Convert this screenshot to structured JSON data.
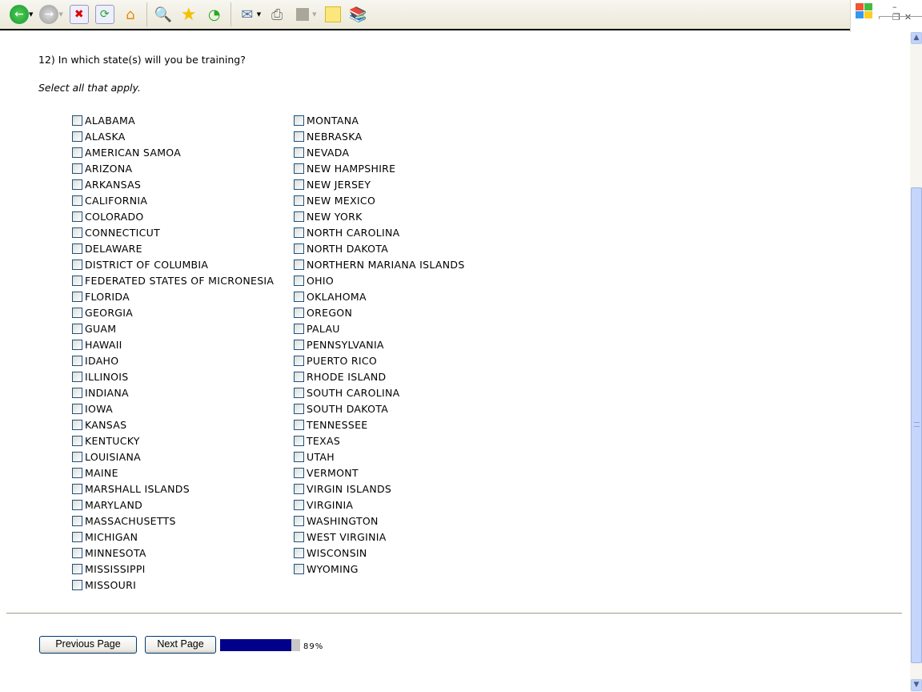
{
  "toolbar": {
    "icons": [
      "back-icon",
      "forward-icon",
      "stop-icon",
      "refresh-icon",
      "home-icon",
      "search-icon",
      "favorites-icon",
      "history-icon",
      "mail-icon",
      "print-icon",
      "edit-icon",
      "notes-icon",
      "research-icon"
    ]
  },
  "window_controls": {
    "minimize": "–",
    "restore": "❐",
    "close": "✕"
  },
  "question": "12) In which state(s) will you be training?",
  "instruction": "Select all that apply.",
  "column1": [
    "ALABAMA",
    "ALASKA",
    "AMERICAN SAMOA",
    "ARIZONA",
    "ARKANSAS",
    "CALIFORNIA",
    "COLORADO",
    "CONNECTICUT",
    "DELAWARE",
    "DISTRICT OF COLUMBIA",
    "FEDERATED STATES OF MICRONESIA",
    "FLORIDA",
    "GEORGIA",
    "GUAM",
    "HAWAII",
    "IDAHO",
    "ILLINOIS",
    "INDIANA",
    "IOWA",
    "KANSAS",
    "KENTUCKY",
    "LOUISIANA",
    "MAINE",
    "MARSHALL ISLANDS",
    "MARYLAND",
    "MASSACHUSETTS",
    "MICHIGAN",
    "MINNESOTA",
    "MISSISSIPPI",
    "MISSOURI"
  ],
  "column2": [
    "MONTANA",
    "NEBRASKA",
    "NEVADA",
    "NEW HAMPSHIRE",
    "NEW JERSEY",
    "NEW MEXICO",
    "NEW YORK",
    "NORTH CAROLINA",
    "NORTH DAKOTA",
    "NORTHERN MARIANA ISLANDS",
    "OHIO",
    "OKLAHOMA",
    "OREGON",
    "PALAU",
    "PENNSYLVANIA",
    "PUERTO RICO",
    "RHODE ISLAND",
    "SOUTH CAROLINA",
    "SOUTH DAKOTA",
    "TENNESSEE",
    "TEXAS",
    "UTAH",
    "VERMONT",
    "VIRGIN ISLANDS",
    "VIRGINIA",
    "WASHINGTON",
    "WEST VIRGINIA",
    "WISCONSIN",
    "WYOMING"
  ],
  "nav": {
    "previous": "Previous Page",
    "next": "Next Page"
  },
  "progress": {
    "value": 89,
    "label": "89%",
    "fill_color": "#00008b"
  }
}
